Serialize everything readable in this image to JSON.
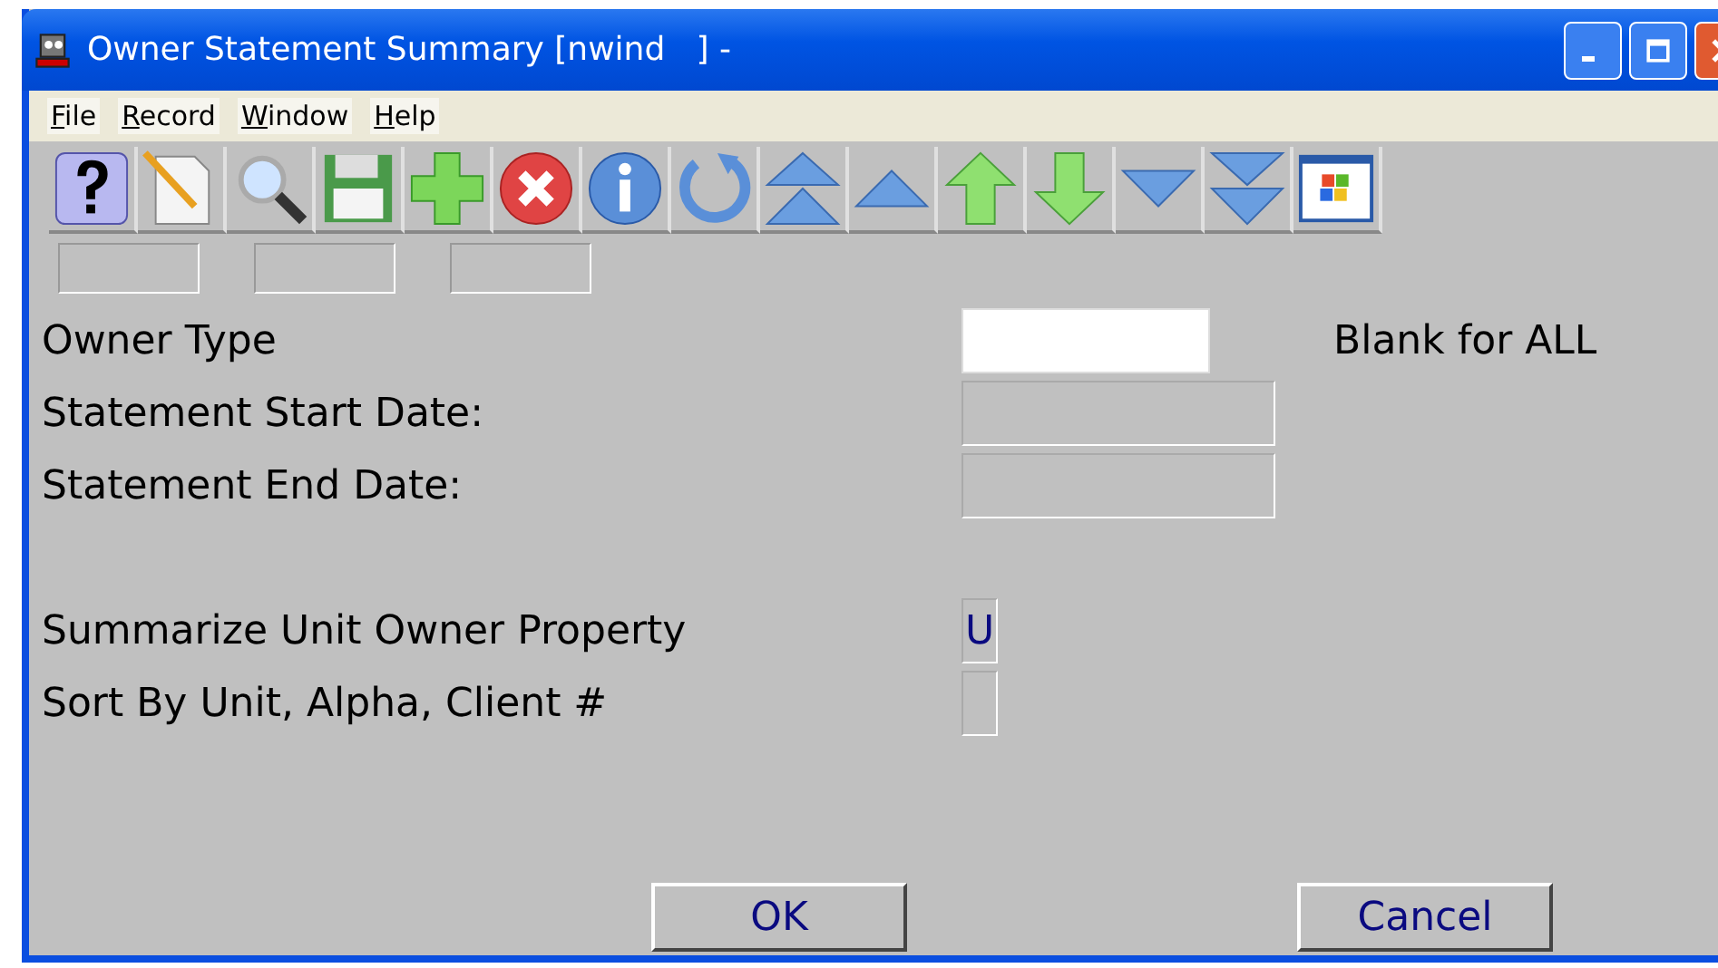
{
  "window": {
    "title": "Owner Statement Summary [nwind   ] -"
  },
  "menu": [
    "File",
    "Record",
    "Window",
    "Help"
  ],
  "fields": [
    {
      "label": "Owner Type",
      "kind": "code",
      "disabled": false,
      "hint": "Blank for ALL"
    },
    {
      "label": "Statement Start Date:",
      "kind": "date",
      "disabled": true
    },
    {
      "label": "Statement End Date:",
      "kind": "date",
      "disabled": true
    },
    {
      "label": "Summarize Unit Owner Property",
      "kind": "flag",
      "value": "U",
      "disabled": true
    },
    {
      "label": "Sort By Unit, Alpha, Client #",
      "kind": "flag",
      "disabled": true
    }
  ],
  "buttons": [
    "OK",
    "Cancel"
  ]
}
